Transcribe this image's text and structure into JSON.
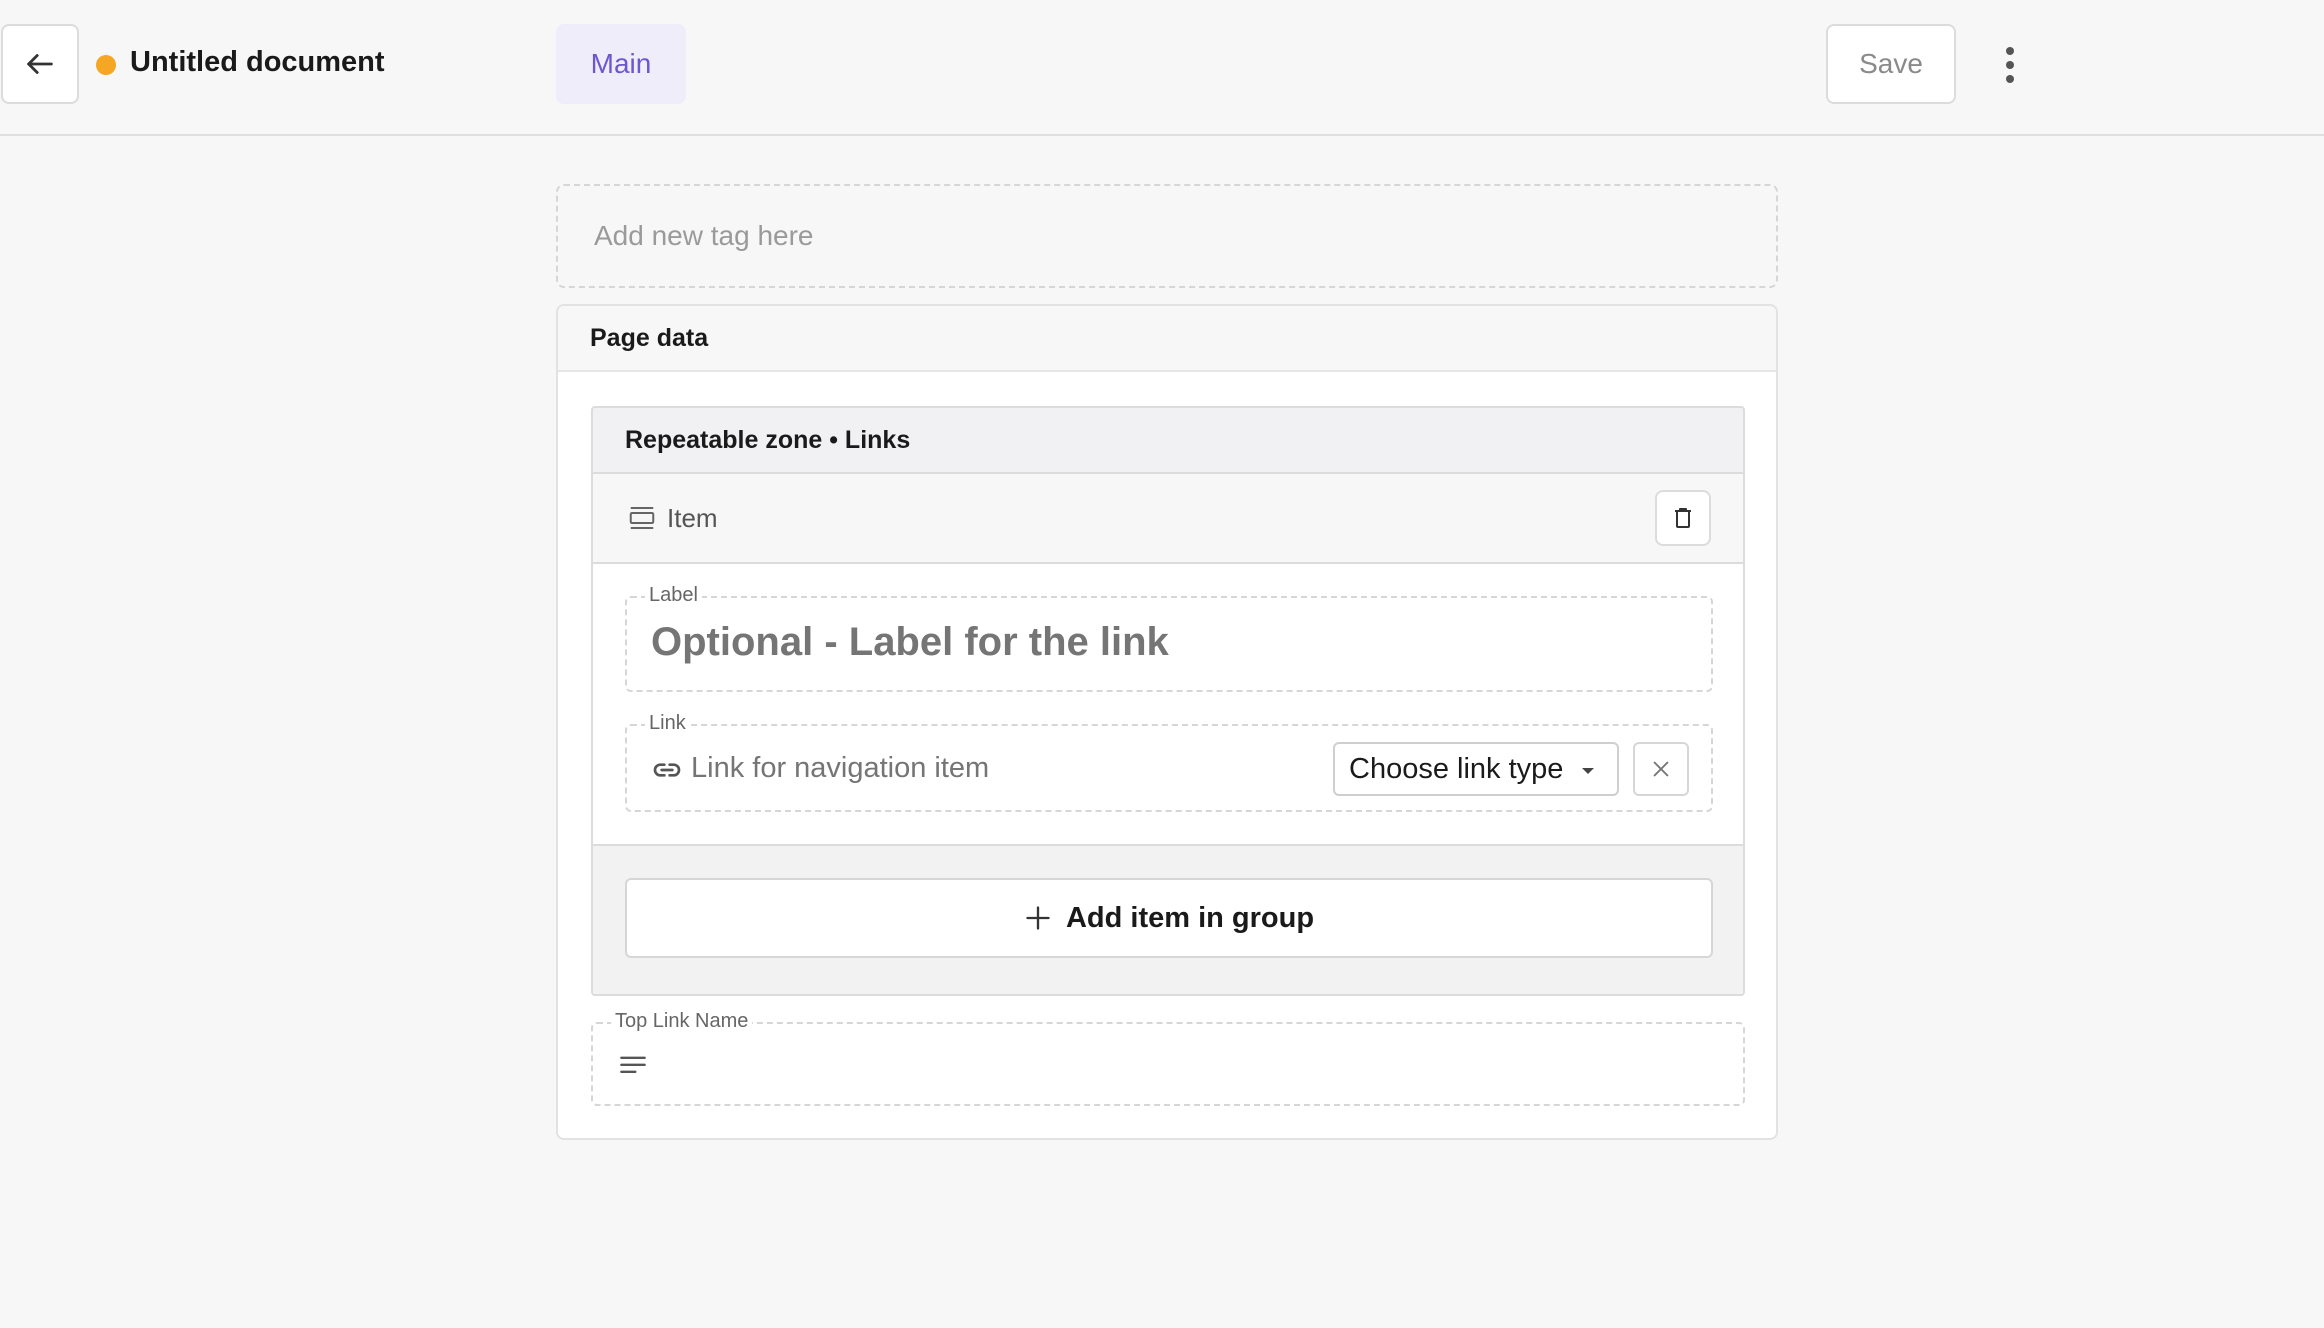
{
  "header": {
    "back_icon": "arrow-left-icon",
    "status_color": "#f5a623",
    "document_title": "Untitled document",
    "tab_main": "Main",
    "tab_main_color": "#6e56cf",
    "tab_main_bg": "#efedfa",
    "save_label": "Save",
    "more_icon": "kebab-menu-icon"
  },
  "tags": {
    "placeholder": "Add new tag here"
  },
  "page_data": {
    "title": "Page data",
    "zone": {
      "title": "Repeatable zone • Links",
      "item": {
        "label": "Item",
        "icon": "item-stack-icon",
        "delete_icon": "trash-icon"
      },
      "fields": {
        "label": {
          "legend": "Label",
          "placeholder": "Optional - Label for the link"
        },
        "link": {
          "legend": "Link",
          "placeholder": "Link for navigation item",
          "icon": "link-icon",
          "type_select": "Choose link type",
          "clear_icon": "close-icon"
        }
      },
      "add_button": "Add item in group"
    },
    "top_link": {
      "legend": "Top Link Name",
      "icon": "text-lines-icon"
    }
  }
}
